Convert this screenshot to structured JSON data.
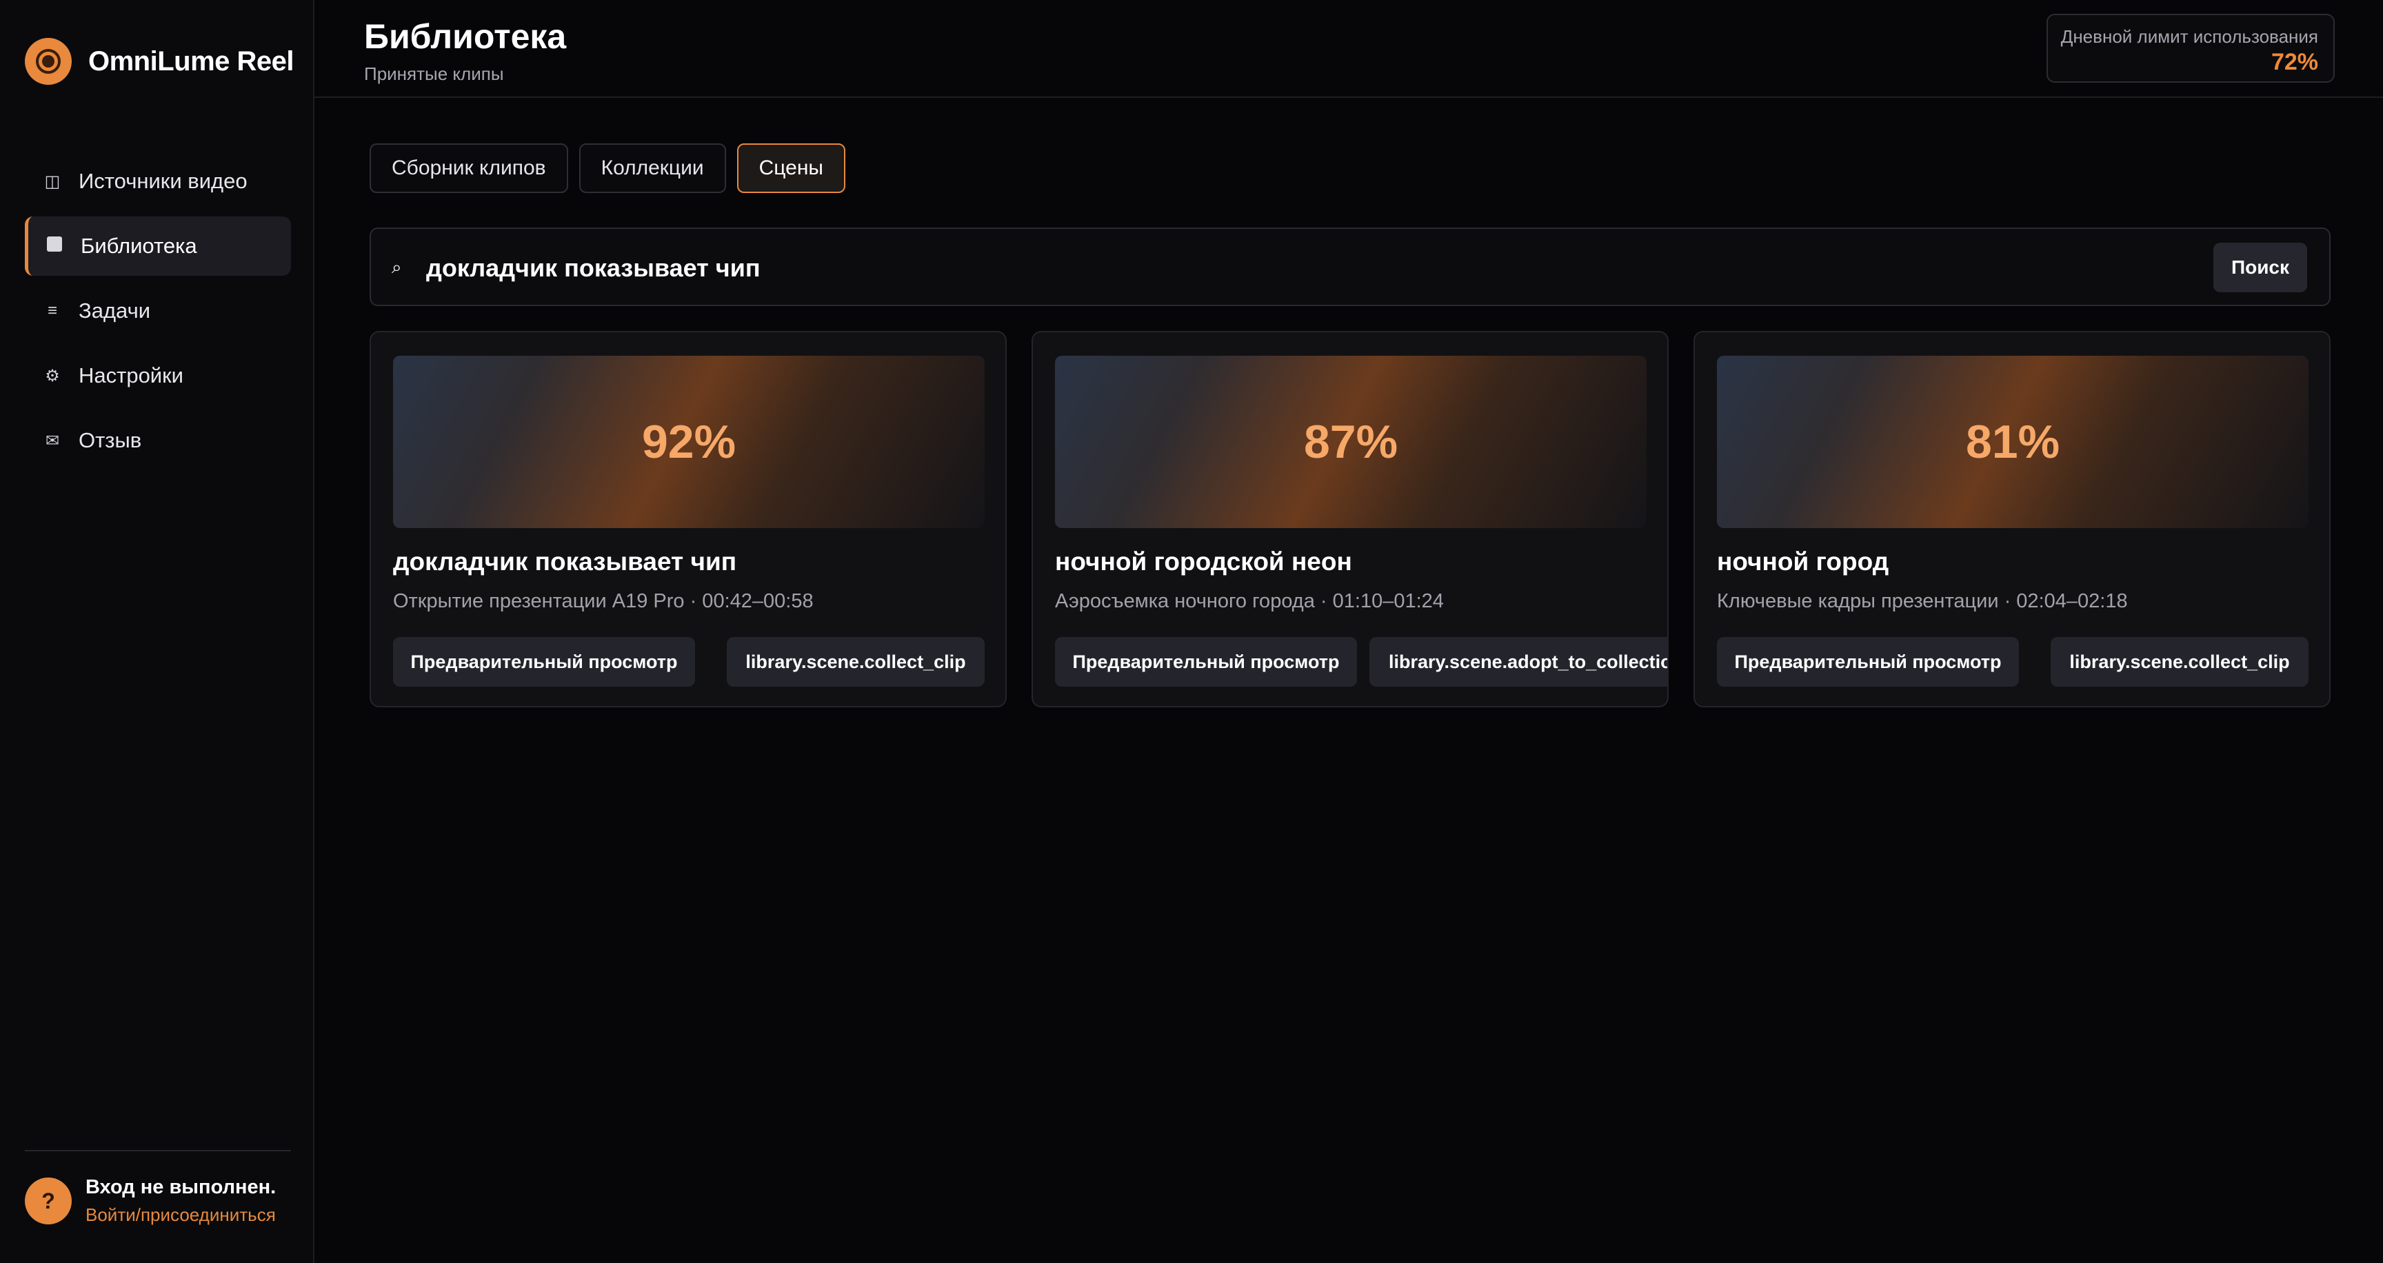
{
  "app": {
    "name": "OmniLume Reel"
  },
  "sidebar": {
    "items": [
      {
        "label": "Источники видео",
        "icon": "columns-icon",
        "glyph": "◫"
      },
      {
        "label": "Библиотека",
        "icon": "square-icon",
        "glyph": ""
      },
      {
        "label": "Задачи",
        "icon": "list-icon",
        "glyph": "≡"
      },
      {
        "label": "Настройки",
        "icon": "gear-icon",
        "glyph": "⚙"
      },
      {
        "label": "Отзыв",
        "icon": "mail-icon",
        "glyph": "✉"
      }
    ],
    "active_index": 1
  },
  "user": {
    "avatar": "?",
    "status": "Вход не выполнен.",
    "link": "Войти/присоединиться"
  },
  "header": {
    "title": "Библиотека",
    "subtitle": "Принятые клипы",
    "limit_label": "Дневной лимит использования",
    "limit_value": "72%"
  },
  "tabs": [
    "Сборник клипов",
    "Коллекции",
    "Сцены"
  ],
  "active_tab": 2,
  "search": {
    "icon": "search-icon",
    "glyph": "⌕",
    "query": "докладчик показывает чип",
    "button": "Поиск"
  },
  "cards": [
    {
      "score": "92%",
      "title": "докладчик показывает чип",
      "meta": "Открытие презентации A19 Pro · 00:42–00:58",
      "preview": "Предварительный просмотр",
      "action": "library.scene.collect_clip"
    },
    {
      "score": "87%",
      "title": "ночной городской неон",
      "meta": "Аэросъемка ночного города · 01:10–01:24",
      "preview": "Предварительный просмотр",
      "action": "library.scene.adopt_to_collection"
    },
    {
      "score": "81%",
      "title": "ночной город",
      "meta": "Ключевые кадры презентации · 02:04–02:18",
      "preview": "Предварительный просмотр",
      "action": "library.scene.collect_clip"
    }
  ],
  "colors": {
    "accent": "#e8893d",
    "background": "#060608",
    "panel": "#111114",
    "score": "#f6a869"
  }
}
